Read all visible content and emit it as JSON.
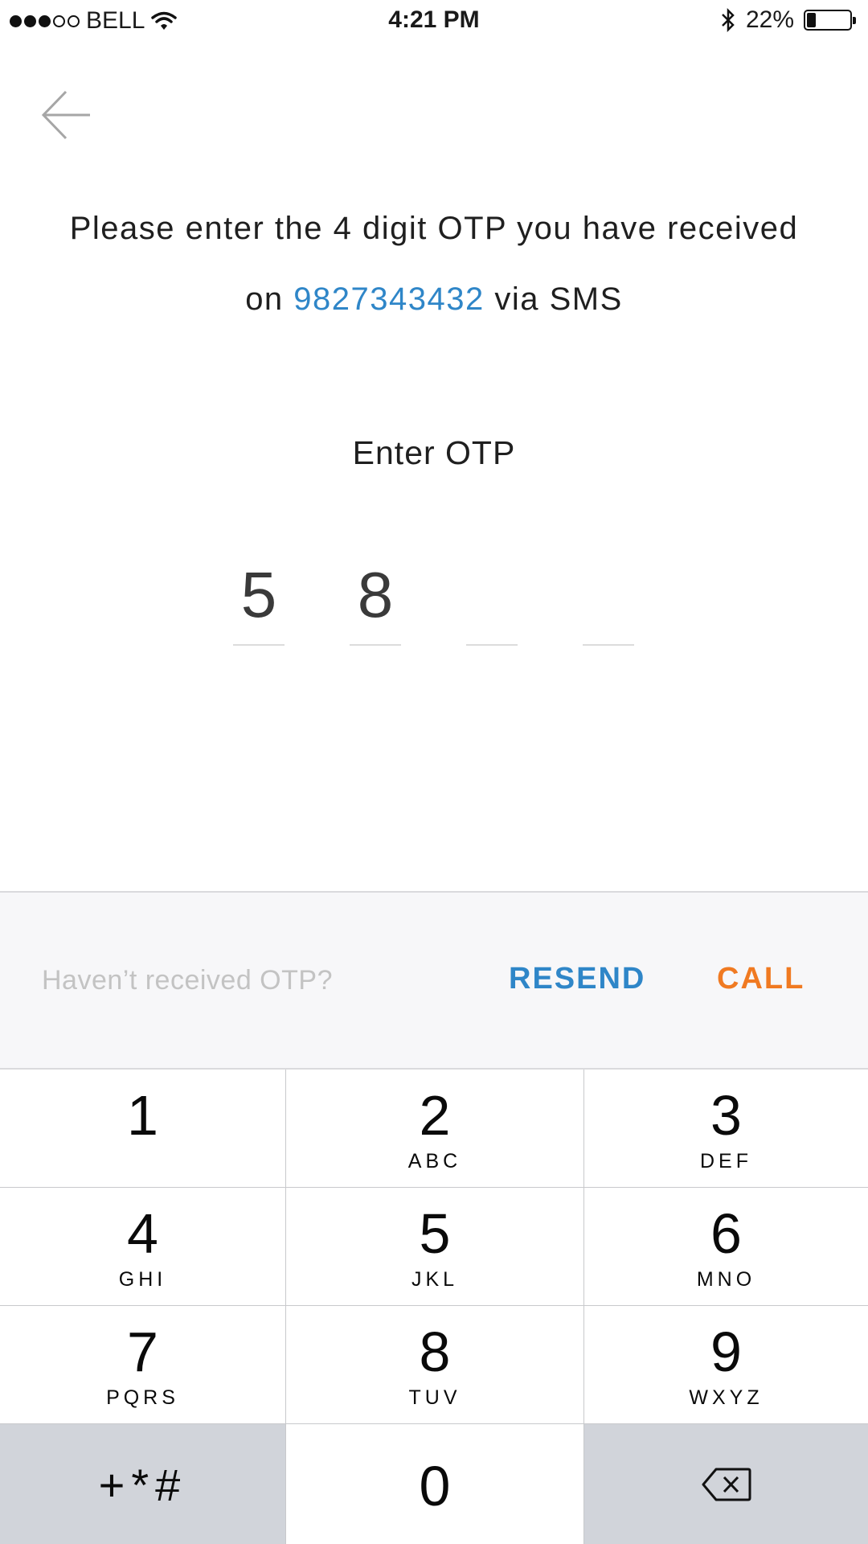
{
  "status_bar": {
    "carrier": "BELL",
    "time": "4:21 PM",
    "battery_percent": "22%",
    "battery_level": 0.22,
    "signal_dots_filled": 3,
    "signal_dots_total": 5,
    "icons": [
      "wifi-icon",
      "bluetooth-icon",
      "battery-icon"
    ]
  },
  "header": {
    "back_icon": "back-arrow-icon"
  },
  "instruction": {
    "before": "Please enter the 4 digit OTP you have received on ",
    "phone": "9827343432",
    "after": " via SMS"
  },
  "otp": {
    "label": "Enter OTP",
    "digits": [
      "5",
      "8",
      "",
      ""
    ]
  },
  "resend": {
    "question": "Haven’t received OTP?",
    "resend_label": "RESEND",
    "call_label": "CALL"
  },
  "keypad": {
    "keys": [
      {
        "num": "1",
        "letters": ""
      },
      {
        "num": "2",
        "letters": "ABC"
      },
      {
        "num": "3",
        "letters": "DEF"
      },
      {
        "num": "4",
        "letters": "GHI"
      },
      {
        "num": "5",
        "letters": "JKL"
      },
      {
        "num": "6",
        "letters": "MNO"
      },
      {
        "num": "7",
        "letters": "PQRS"
      },
      {
        "num": "8",
        "letters": "TUV"
      },
      {
        "num": "9",
        "letters": "WXYZ"
      }
    ],
    "symbols": "+*#",
    "zero": "0",
    "delete_icon": "backspace-icon"
  },
  "colors": {
    "accent_blue": "#2f86c8",
    "accent_orange": "#f07a22",
    "muted_text": "#c3c3c3",
    "keypad_dark": "#d1d4da"
  }
}
